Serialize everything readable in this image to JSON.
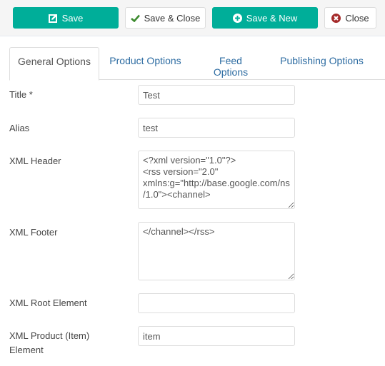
{
  "toolbar": {
    "save_label": "Save",
    "save_close_label": "Save & Close",
    "save_new_label": "Save & New",
    "close_label": "Close"
  },
  "colors": {
    "primary": "#00ae99",
    "close_icon": "#a52a2a",
    "check_icon": "#3c8a2e",
    "tab_link": "#2d6ca2"
  },
  "tabs": [
    {
      "label": "General Options",
      "active": true
    },
    {
      "label": "Product Options",
      "active": false
    },
    {
      "label": "Feed Options",
      "active": false
    },
    {
      "label": "Publishing Options",
      "active": false
    }
  ],
  "form": {
    "title": {
      "label": "Title *",
      "value": "Test"
    },
    "alias": {
      "label": "Alias",
      "value": "test"
    },
    "xml_header": {
      "label": "XML Header",
      "value": "<?xml version=\"1.0\"?>\n<rss version=\"2.0\"\nxmlns:g=\"http://base.google.com/ns/1.0\"><channel>"
    },
    "xml_footer": {
      "label": "XML Footer",
      "value": "</channel></rss>"
    },
    "xml_root": {
      "label": "XML Root Element",
      "value": ""
    },
    "xml_item": {
      "label": "XML Product (Item) Element",
      "value": "item"
    }
  }
}
